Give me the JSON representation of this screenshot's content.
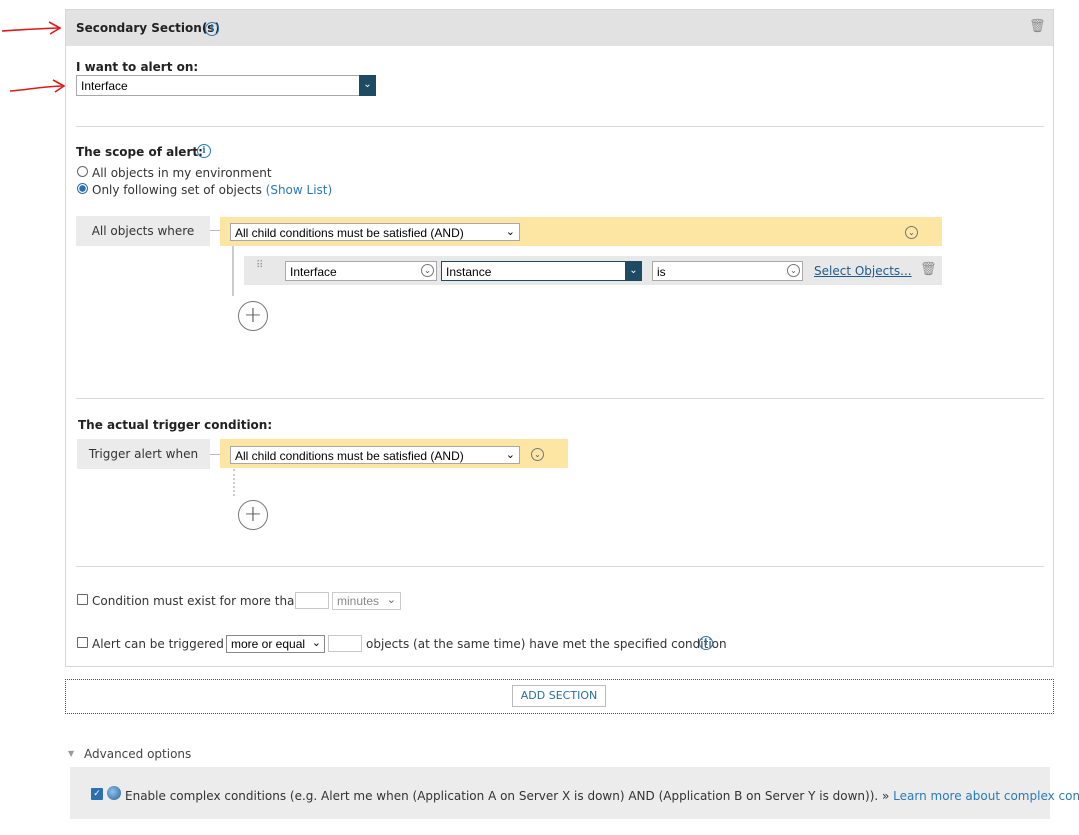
{
  "section": {
    "title": "Secondary Section(s)",
    "alert_on_label": "I want to alert on:",
    "alert_on_value": "Interface"
  },
  "scope": {
    "label": "The scope of alert:",
    "option_all": "All objects in my environment",
    "option_following": "Only following set of objects",
    "show_list": "(Show List)",
    "selected": "option_following",
    "where_label": "All objects where",
    "group_logic": "All child conditions must be satisfied (AND)",
    "condition": {
      "field1": "Interface",
      "field2": "Instance",
      "operator": "is",
      "select_link": "Select Objects..."
    }
  },
  "trigger": {
    "label": "The actual trigger condition:",
    "when_label": "Trigger alert when",
    "group_logic": "All child conditions must be satisfied (AND)"
  },
  "options": {
    "condition_exist_text": "Condition must exist for more than",
    "condition_exist_unit": "minutes",
    "condition_exist_value": "",
    "triggered_if_text": "Alert can be triggered if",
    "triggered_if_select": "more or equal",
    "triggered_if_value": "",
    "triggered_if_suffix": "objects (at the same time) have met the specified condition"
  },
  "add_section_label": "ADD SECTION",
  "advanced": {
    "label": "Advanced options",
    "complex_text": "Enable complex conditions (e.g. Alert me when (Application A on Server X is down) AND (Application B on Server Y is down)). »",
    "complex_link": "Learn more about complex conditions",
    "complex_checked": true
  },
  "colors": {
    "accent": "#2a7ab8",
    "dropdown_dark": "#1e4a63",
    "yellow_bar": "#fde6a3",
    "annotation_red": "#e01818"
  }
}
